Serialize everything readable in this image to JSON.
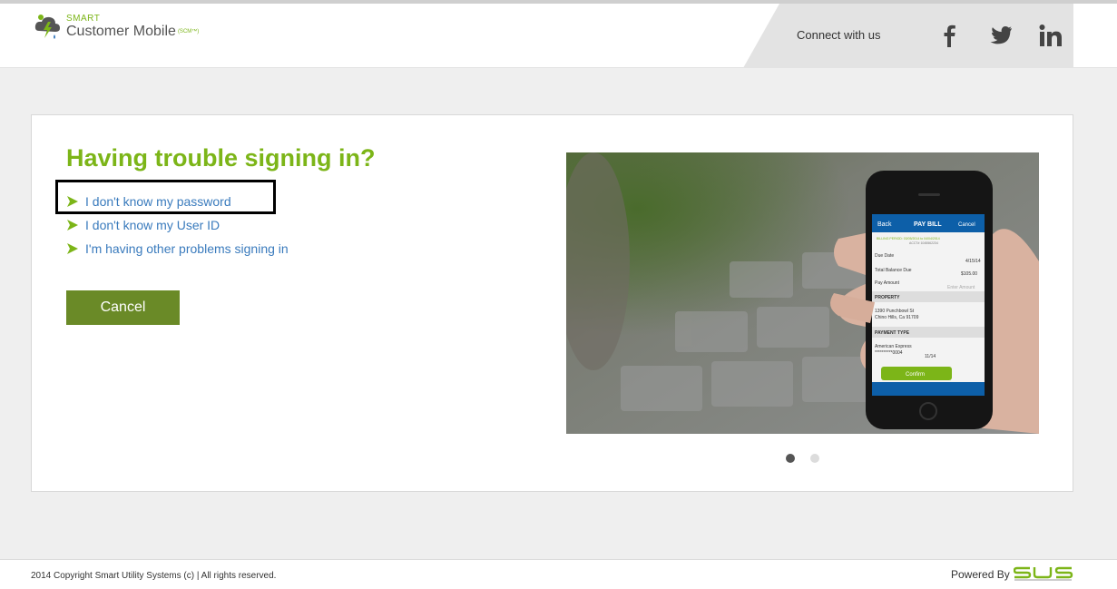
{
  "header": {
    "logo_small": "SMART",
    "logo_big": "Customer Mobile",
    "logo_tm": "(SCM™)",
    "connect_text": "Connect with us",
    "social": [
      "facebook-icon",
      "twitter-icon",
      "linkedin-icon"
    ]
  },
  "main": {
    "title": "Having trouble signing in?",
    "links": [
      "I don't know my password",
      "I don't know my User ID",
      "I'm having other problems signing in"
    ],
    "cancel_label": "Cancel",
    "carousel": {
      "slide_count": 2,
      "active_slide": 1,
      "phone_screen": {
        "back": "Back",
        "title": "PAY BILL",
        "cancel": "Cancel",
        "billing_period": "BILLING PERIOD: 03/05/2014 to 04/04/2014",
        "account": "ACCT# 1045562234",
        "due_date_label": "Due Date",
        "due_date": "4/15/14",
        "total_label": "Total Balance Due",
        "total": "$105.00",
        "pay_label": "Pay Amount",
        "pay_placeholder": "Enter Amount",
        "property_header": "PROPERTY",
        "address1": "1390 Punchbowl St",
        "address2": "Chino Hills, Ca 91709",
        "payment_header": "PAYMENT TYPE",
        "card_name": "American Express",
        "card_number": "**********0004",
        "card_exp": "11/14",
        "confirm": "Confirm"
      }
    }
  },
  "footer": {
    "copyright": "2014 Copyright Smart Utility Systems (c) | All rights reserved.",
    "powered": "Powered By"
  },
  "colors": {
    "brand_green": "#7cb518",
    "button_green": "#6a8a27",
    "link_blue": "#3a7bbd"
  }
}
